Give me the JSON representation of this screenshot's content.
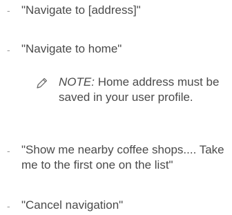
{
  "list": {
    "bullet": "-",
    "items": [
      {
        "text": "\"Navigate to [address]\""
      },
      {
        "text": "\"Navigate to home\""
      },
      {
        "text": "\"Show me nearby coffee shops.... Take me to the first one on the list\""
      },
      {
        "text": "\"Cancel navigation\""
      }
    ]
  },
  "note": {
    "icon": "pencil-icon",
    "label": "NOTE:",
    "text": "Home address must be saved in your user profile."
  }
}
